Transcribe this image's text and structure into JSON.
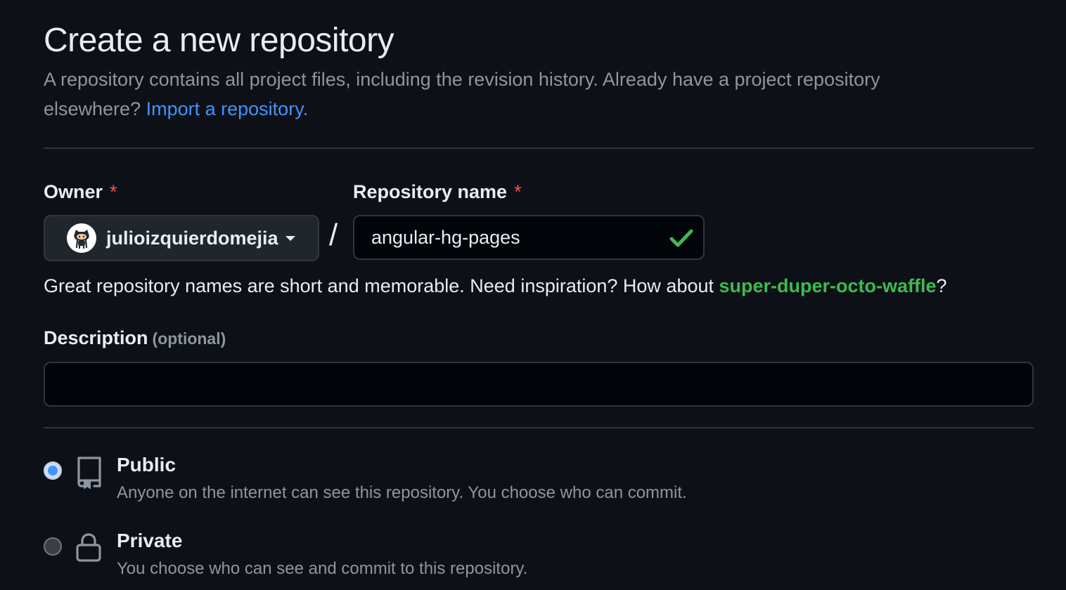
{
  "header": {
    "title": "Create a new repository",
    "subtitle_text": "A repository contains all project files, including the revision history. Already have a project repository elsewhere?",
    "import_link": "Import a repository."
  },
  "owner": {
    "label": "Owner",
    "required_mark": "*",
    "value": "julioizquierdomejia",
    "icon": "octocat-avatar"
  },
  "separator": "/",
  "repo_name": {
    "label": "Repository name",
    "required_mark": "*",
    "value": "angular-hg-pages",
    "status_icon": "check-icon",
    "status_color": "#3fb950"
  },
  "hint": {
    "text": "Great repository names are short and memorable. Need inspiration? How about",
    "suggestion": "super-duper-octo-waffle",
    "suffix": "?"
  },
  "description": {
    "label": "Description",
    "optional_label": "(optional)",
    "value": "",
    "placeholder": ""
  },
  "visibility": {
    "options": [
      {
        "title": "Public",
        "description": "Anyone on the internet can see this repository. You choose who can commit.",
        "icon": "repo-icon",
        "selected": true
      },
      {
        "title": "Private",
        "description": "You choose who can see and commit to this repository.",
        "icon": "lock-icon",
        "selected": false
      }
    ]
  },
  "colors": {
    "background": "#0d1117",
    "link": "#4493f8",
    "success": "#3fb950",
    "required": "#f85149"
  }
}
